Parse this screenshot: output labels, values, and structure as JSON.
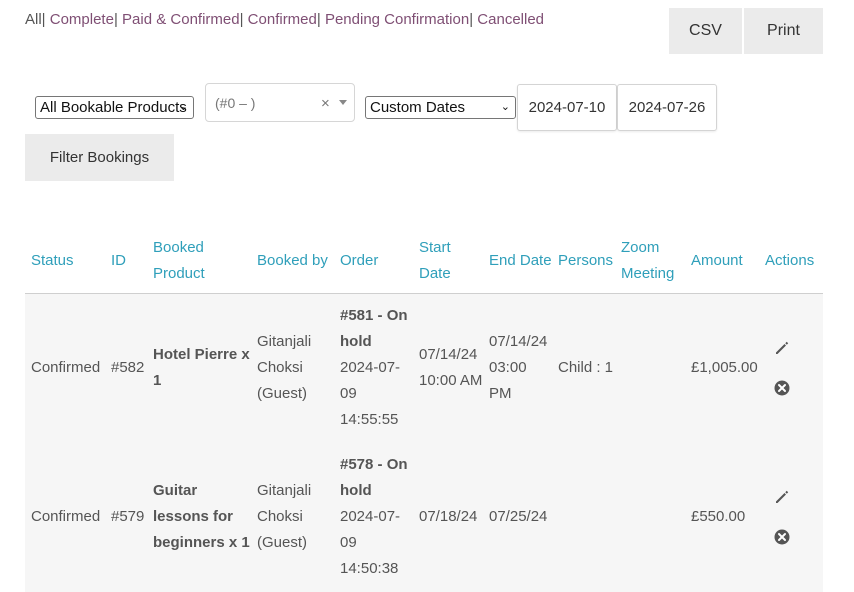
{
  "status_filter": {
    "links": [
      {
        "label": "All",
        "current": true
      },
      {
        "label": "Complete",
        "current": false
      },
      {
        "label": "Paid & Confirmed",
        "current": false
      },
      {
        "label": "Confirmed",
        "current": false
      },
      {
        "label": "Pending Confirmation",
        "current": false
      },
      {
        "label": "Cancelled",
        "current": false
      }
    ],
    "separator": "|"
  },
  "export": {
    "csv_label": "CSV",
    "print_label": "Print"
  },
  "filters": {
    "product_select": "All Bookable Products",
    "resource_select": "(#0 – )",
    "resource_clear": "×",
    "date_range_select": "Custom Dates",
    "date_from": "2024-07-10",
    "date_to": "2024-07-26",
    "filter_button": "Filter Bookings"
  },
  "table": {
    "headers": [
      "Status",
      "ID",
      "Booked Product",
      "Booked by",
      "Order",
      "Start Date",
      "End Date",
      "Persons",
      "Zoom Meeting",
      "Amount",
      "Actions"
    ],
    "rows": [
      {
        "status": "Confirmed",
        "id": "#582",
        "product": "Hotel Pierre x 1",
        "booked_by": "Gitanjali Choksi (Guest)",
        "order_title": "#581 - On hold",
        "order_date": "2024-07-09 14:55:55",
        "start": "07/14/24 10:00 AM",
        "end": "07/14/24 03:00 PM",
        "persons": "Child : 1",
        "zoom": "",
        "amount": "£1,005.00"
      },
      {
        "status": "Confirmed",
        "id": "#579",
        "product": "Guitar lessons for beginners x 1",
        "booked_by": "Gitanjali Choksi (Guest)",
        "order_title": "#578 - On hold",
        "order_date": "2024-07-09 14:50:38",
        "start": "07/18/24",
        "end": "07/25/24",
        "persons": "",
        "zoom": "",
        "amount": "£550.00"
      }
    ]
  },
  "icons": {
    "edit": "pencil-icon",
    "cancel": "cancel-circle-icon"
  },
  "colors": {
    "link": "#7f4f74",
    "header": "#2f9fba",
    "button_bg": "#ebebeb",
    "row_bg": "#f6f6f6"
  }
}
